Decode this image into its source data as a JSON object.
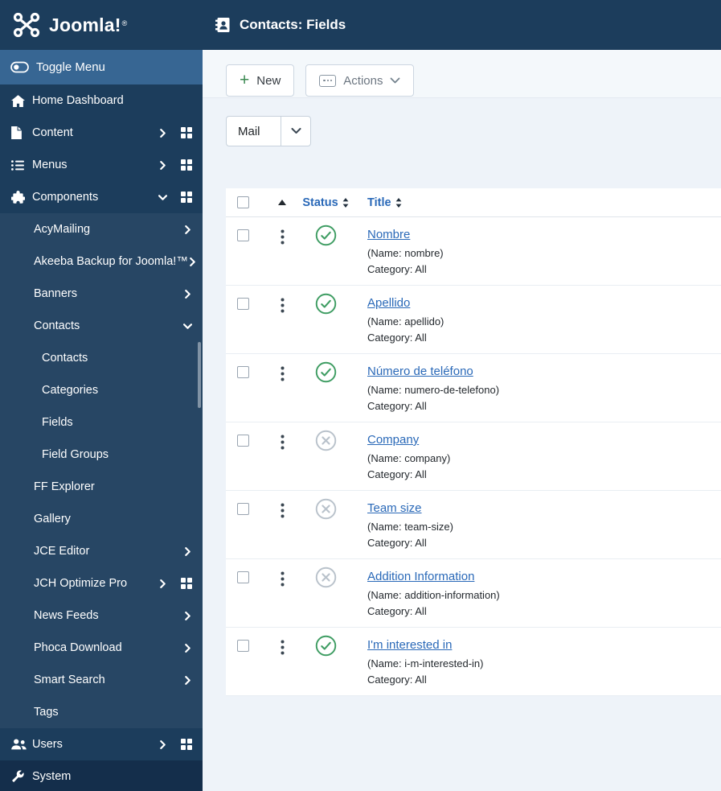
{
  "brand": {
    "logo_text": "Joomla!",
    "registered_mark": "®"
  },
  "header": {
    "title": "Contacts: Fields"
  },
  "toolbar": {
    "new_label": "New",
    "actions_label": "Actions"
  },
  "filter": {
    "selected_option": "Mail"
  },
  "table": {
    "headers": {
      "status": "Status",
      "title": "Title"
    },
    "rows": [
      {
        "status": "published",
        "title": "Nombre",
        "name": "(Name: nombre)",
        "category": "Category: All"
      },
      {
        "status": "published",
        "title": "Apellido",
        "name": "(Name: apellido)",
        "category": "Category: All"
      },
      {
        "status": "published",
        "title": "Número de teléfono",
        "name": "(Name: numero-de-telefono)",
        "category": "Category: All"
      },
      {
        "status": "unpublished",
        "title": "Company",
        "name": "(Name: company)",
        "category": "Category: All"
      },
      {
        "status": "unpublished",
        "title": "Team size",
        "name": "(Name: team-size)",
        "category": "Category: All"
      },
      {
        "status": "unpublished",
        "title": "Addition Information",
        "name": "(Name: addition-information)",
        "category": "Category: All"
      },
      {
        "status": "published",
        "title": "I'm interested in",
        "name": "(Name: i-m-interested-in)",
        "category": "Category: All"
      }
    ]
  },
  "sidebar": {
    "toggle_label": "Toggle Menu",
    "items": [
      {
        "label": "Home Dashboard",
        "icon": "home",
        "level": 0
      },
      {
        "label": "Content",
        "icon": "content",
        "level": 0,
        "chevron": "right",
        "grid": true
      },
      {
        "label": "Menus",
        "icon": "menus",
        "level": 0,
        "chevron": "right",
        "grid": true
      },
      {
        "label": "Components",
        "icon": "components",
        "level": 0,
        "chevron": "down",
        "grid": true
      },
      {
        "label": "AcyMailing",
        "level": 1,
        "chevron": "right"
      },
      {
        "label": "Akeeba Backup for Joomla!™",
        "level": 1,
        "chevron": "right"
      },
      {
        "label": "Banners",
        "level": 1,
        "chevron": "right"
      },
      {
        "label": "Contacts",
        "level": 1,
        "chevron": "down"
      },
      {
        "label": "Contacts",
        "level": 2
      },
      {
        "label": "Categories",
        "level": 2
      },
      {
        "label": "Fields",
        "level": 2
      },
      {
        "label": "Field Groups",
        "level": 2
      },
      {
        "label": "FF Explorer",
        "level": 1
      },
      {
        "label": "Gallery",
        "level": 1
      },
      {
        "label": "JCE Editor",
        "level": 1,
        "chevron": "right"
      },
      {
        "label": "JCH Optimize Pro",
        "level": 1,
        "chevron": "right",
        "grid": true
      },
      {
        "label": "News Feeds",
        "level": 1,
        "chevron": "right"
      },
      {
        "label": "Phoca Download",
        "level": 1,
        "chevron": "right"
      },
      {
        "label": "Smart Search",
        "level": 1,
        "chevron": "right"
      },
      {
        "label": "Tags",
        "level": 1
      },
      {
        "label": "Users",
        "icon": "users",
        "level": 0,
        "chevron": "right",
        "grid": true
      },
      {
        "label": "System",
        "icon": "system",
        "level": 0,
        "dark": true
      }
    ]
  },
  "colors": {
    "topbar_bg": "#1c3d5c",
    "toggle_row_bg": "#376693",
    "link_blue": "#2a69b8",
    "published_green": "#3f9d63",
    "unpublished_gray": "#b9c2cb",
    "content_bg": "#eef3f9"
  }
}
